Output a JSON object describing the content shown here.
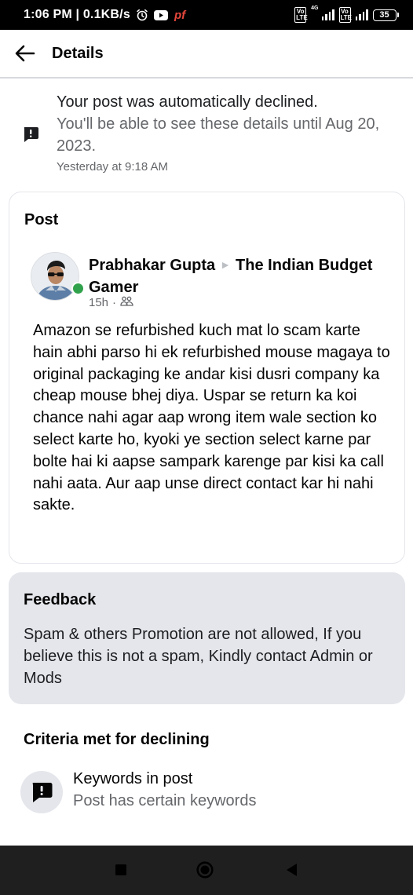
{
  "status_bar": {
    "time": "1:06 PM | 0.1KB/s",
    "app_indicator": "pf",
    "network_label": "4G",
    "volte": "Vo LTE",
    "battery": "35"
  },
  "header": {
    "title": "Details"
  },
  "notice": {
    "title": "Your post was automatically declined.",
    "subtitle": "You'll be able to see these details until Aug 20, 2023.",
    "timestamp": "Yesterday at 9:18 AM"
  },
  "post": {
    "heading": "Post",
    "author": "Prabhakar Gupta",
    "group": "The Indian Budget Gamer",
    "time": "15h",
    "separator": "·",
    "body": "Amazon se refurbished kuch mat lo scam karte hain abhi parso hi ek refurbished mouse magaya to original packaging ke andar kisi dusri company ka cheap mouse bhej diya. Uspar se return ka koi chance nahi agar aap wrong item wale section ko select karte ho, kyoki ye section select karne par bolte hai ki aapse sampark karenge par kisi ka call nahi aata. Aur aap unse direct contact kar hi nahi sakte."
  },
  "feedback": {
    "heading": "Feedback",
    "body": "Spam & others Promotion are not allowed, If you believe this is not a spam, Kindly contact Admin or Mods"
  },
  "criteria": {
    "heading": "Criteria met for declining",
    "items": [
      {
        "title": "Keywords in post",
        "subtitle": "Post has certain keywords",
        "icon": "report-icon"
      }
    ]
  },
  "colors": {
    "primary_text": "#050505",
    "secondary_text": "#65676b",
    "feedback_bg": "#e4e6eb",
    "online": "#31a24c",
    "status_bar_bg": "#000000",
    "nav_bar_bg": "#1f1f1f"
  }
}
